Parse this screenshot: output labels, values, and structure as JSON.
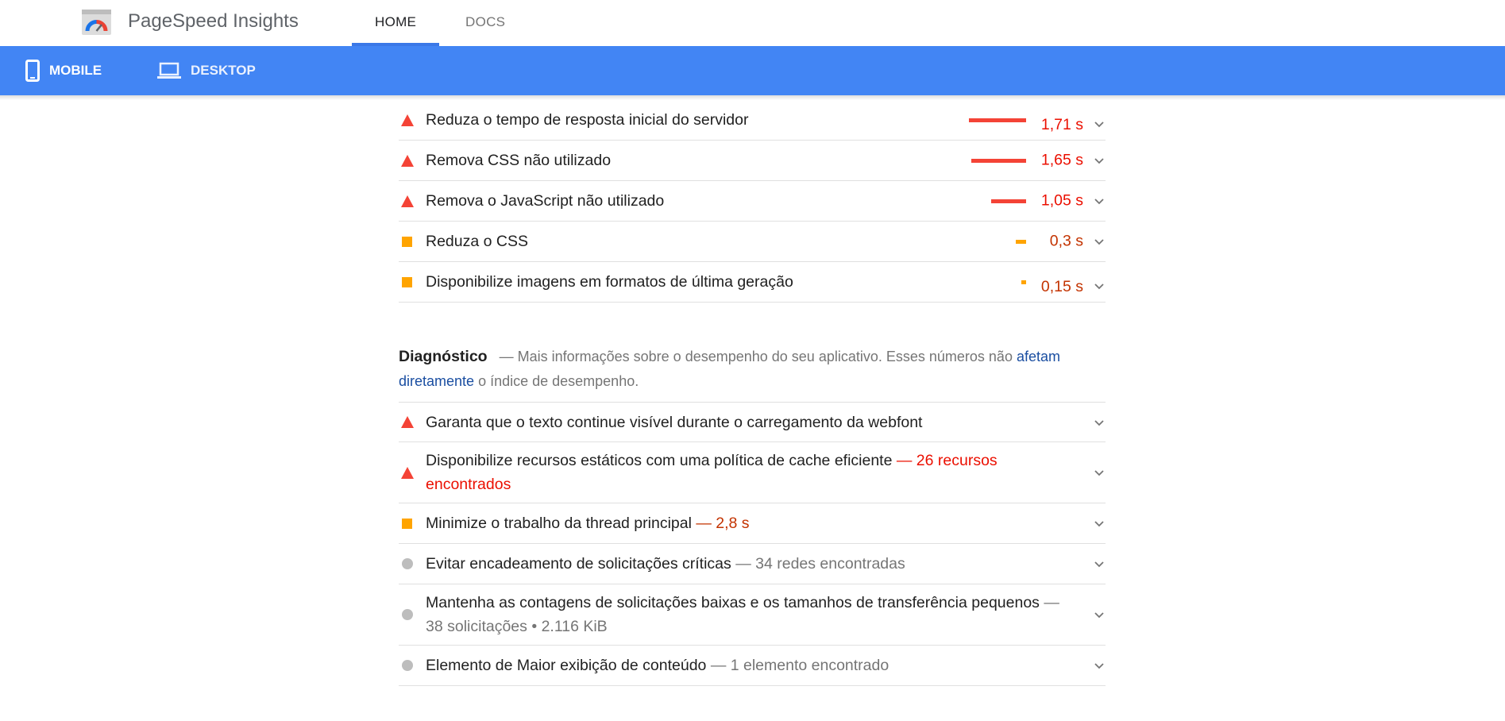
{
  "app": {
    "title": "PageSpeed Insights"
  },
  "nav": {
    "home": "HOME",
    "docs": "DOCS"
  },
  "device_tabs": {
    "mobile": "MOBILE",
    "desktop": "DESKTOP"
  },
  "colors": {
    "accent": "#4285f4",
    "fail": "#f44336",
    "average": "#ffa400",
    "neutral": "#bdbdbd",
    "link": "#1a4ea1"
  },
  "opportunities": [
    {
      "status": "fail",
      "title": "Reduza o tempo de resposta inicial do servidor",
      "value": "1,71 s",
      "bar_fraction": 1.0
    },
    {
      "status": "fail",
      "title": "Remova CSS não utilizado",
      "value": "1,65 s",
      "bar_fraction": 0.965
    },
    {
      "status": "fail",
      "title": "Remova o JavaScript não utilizado",
      "value": "1,05 s",
      "bar_fraction": 0.614
    },
    {
      "status": "average",
      "title": "Reduza o CSS",
      "value": "0,3 s",
      "bar_fraction": 0.175
    },
    {
      "status": "average",
      "title": "Disponibilize imagens em formatos de última geração",
      "value": "0,15 s",
      "bar_fraction": 0.088
    }
  ],
  "diagnostics_header": {
    "title": "Diagnóstico",
    "desc_pre": "— Mais informações sobre o desempenho do seu aplicativo. Esses números não ",
    "link": "afetam diretamente",
    "desc_post": " o índice de desempenho."
  },
  "diagnostics": [
    {
      "status": "fail",
      "title": "Garanta que o texto continue visível durante o carregamento da webfont",
      "detail": ""
    },
    {
      "status": "fail",
      "title": "Disponibilize recursos estáticos com uma política de cache eficiente",
      "detail": "— 26 recursos encontrados"
    },
    {
      "status": "average",
      "title": "Minimize o trabalho da thread principal",
      "detail": "— 2,8 s"
    },
    {
      "status": "neutral",
      "title": "Evitar encadeamento de solicitações críticas",
      "detail": "— 34 redes encontradas"
    },
    {
      "status": "neutral",
      "title": "Mantenha as contagens de solicitações baixas e os tamanhos de transferência pequenos",
      "detail": "— 38 solicitações • 2.116 KiB"
    },
    {
      "status": "neutral",
      "title": "Elemento de Maior exibição de conteúdo",
      "detail": "— 1 elemento encontrado"
    }
  ]
}
